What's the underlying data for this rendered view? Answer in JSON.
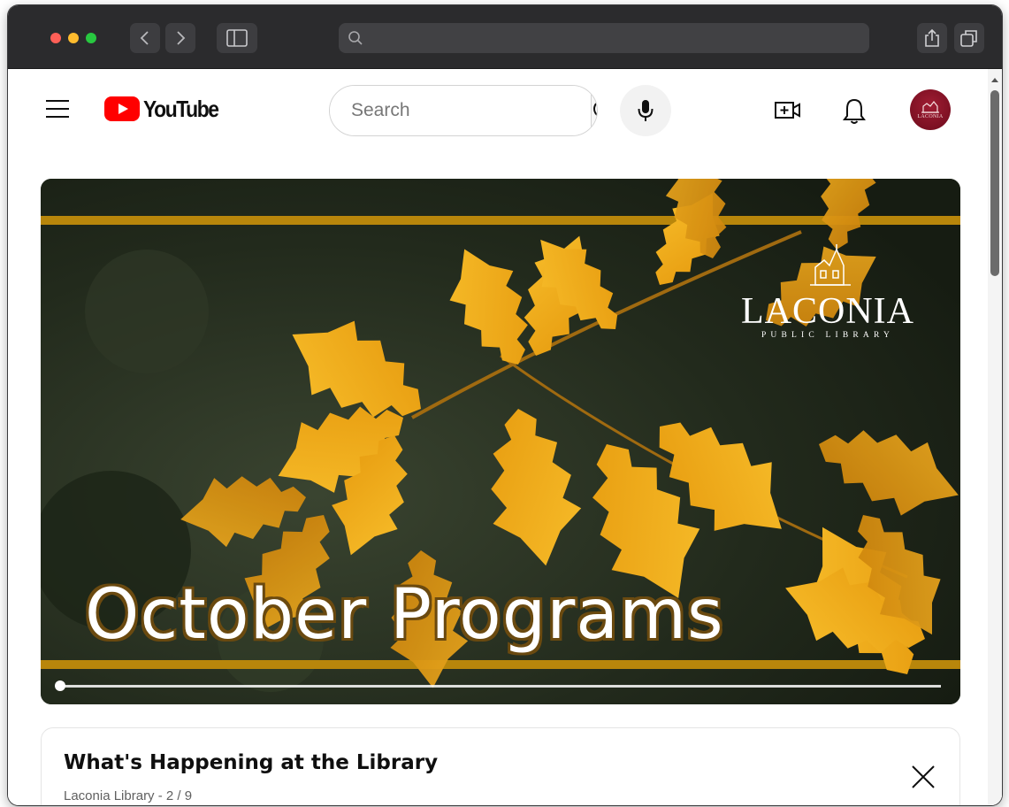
{
  "browser": {
    "icons": [
      "back-icon",
      "forward-icon",
      "sidebar-icon",
      "search-icon",
      "share-icon",
      "tabs-icon"
    ],
    "address_value": ""
  },
  "youtube": {
    "logo_text": "YouTube",
    "search_placeholder": "Search",
    "icons": [
      "menu-icon",
      "search-icon",
      "mic-icon",
      "create-icon",
      "bell-icon",
      "avatar"
    ]
  },
  "banner": {
    "title": "October Programs",
    "brand_name": "LACONIA",
    "brand_sub": "PUBLIC LIBRARY",
    "progress": 0
  },
  "playlist": {
    "title": "What's Happening at the Library",
    "subtitle": "Laconia Library - 2 / 9"
  },
  "colors": {
    "brand_red": "#ff0000",
    "frame_dark": "#2b2b2d",
    "banner_gold": "#b8860b",
    "avatar": "#8b1a2b"
  }
}
